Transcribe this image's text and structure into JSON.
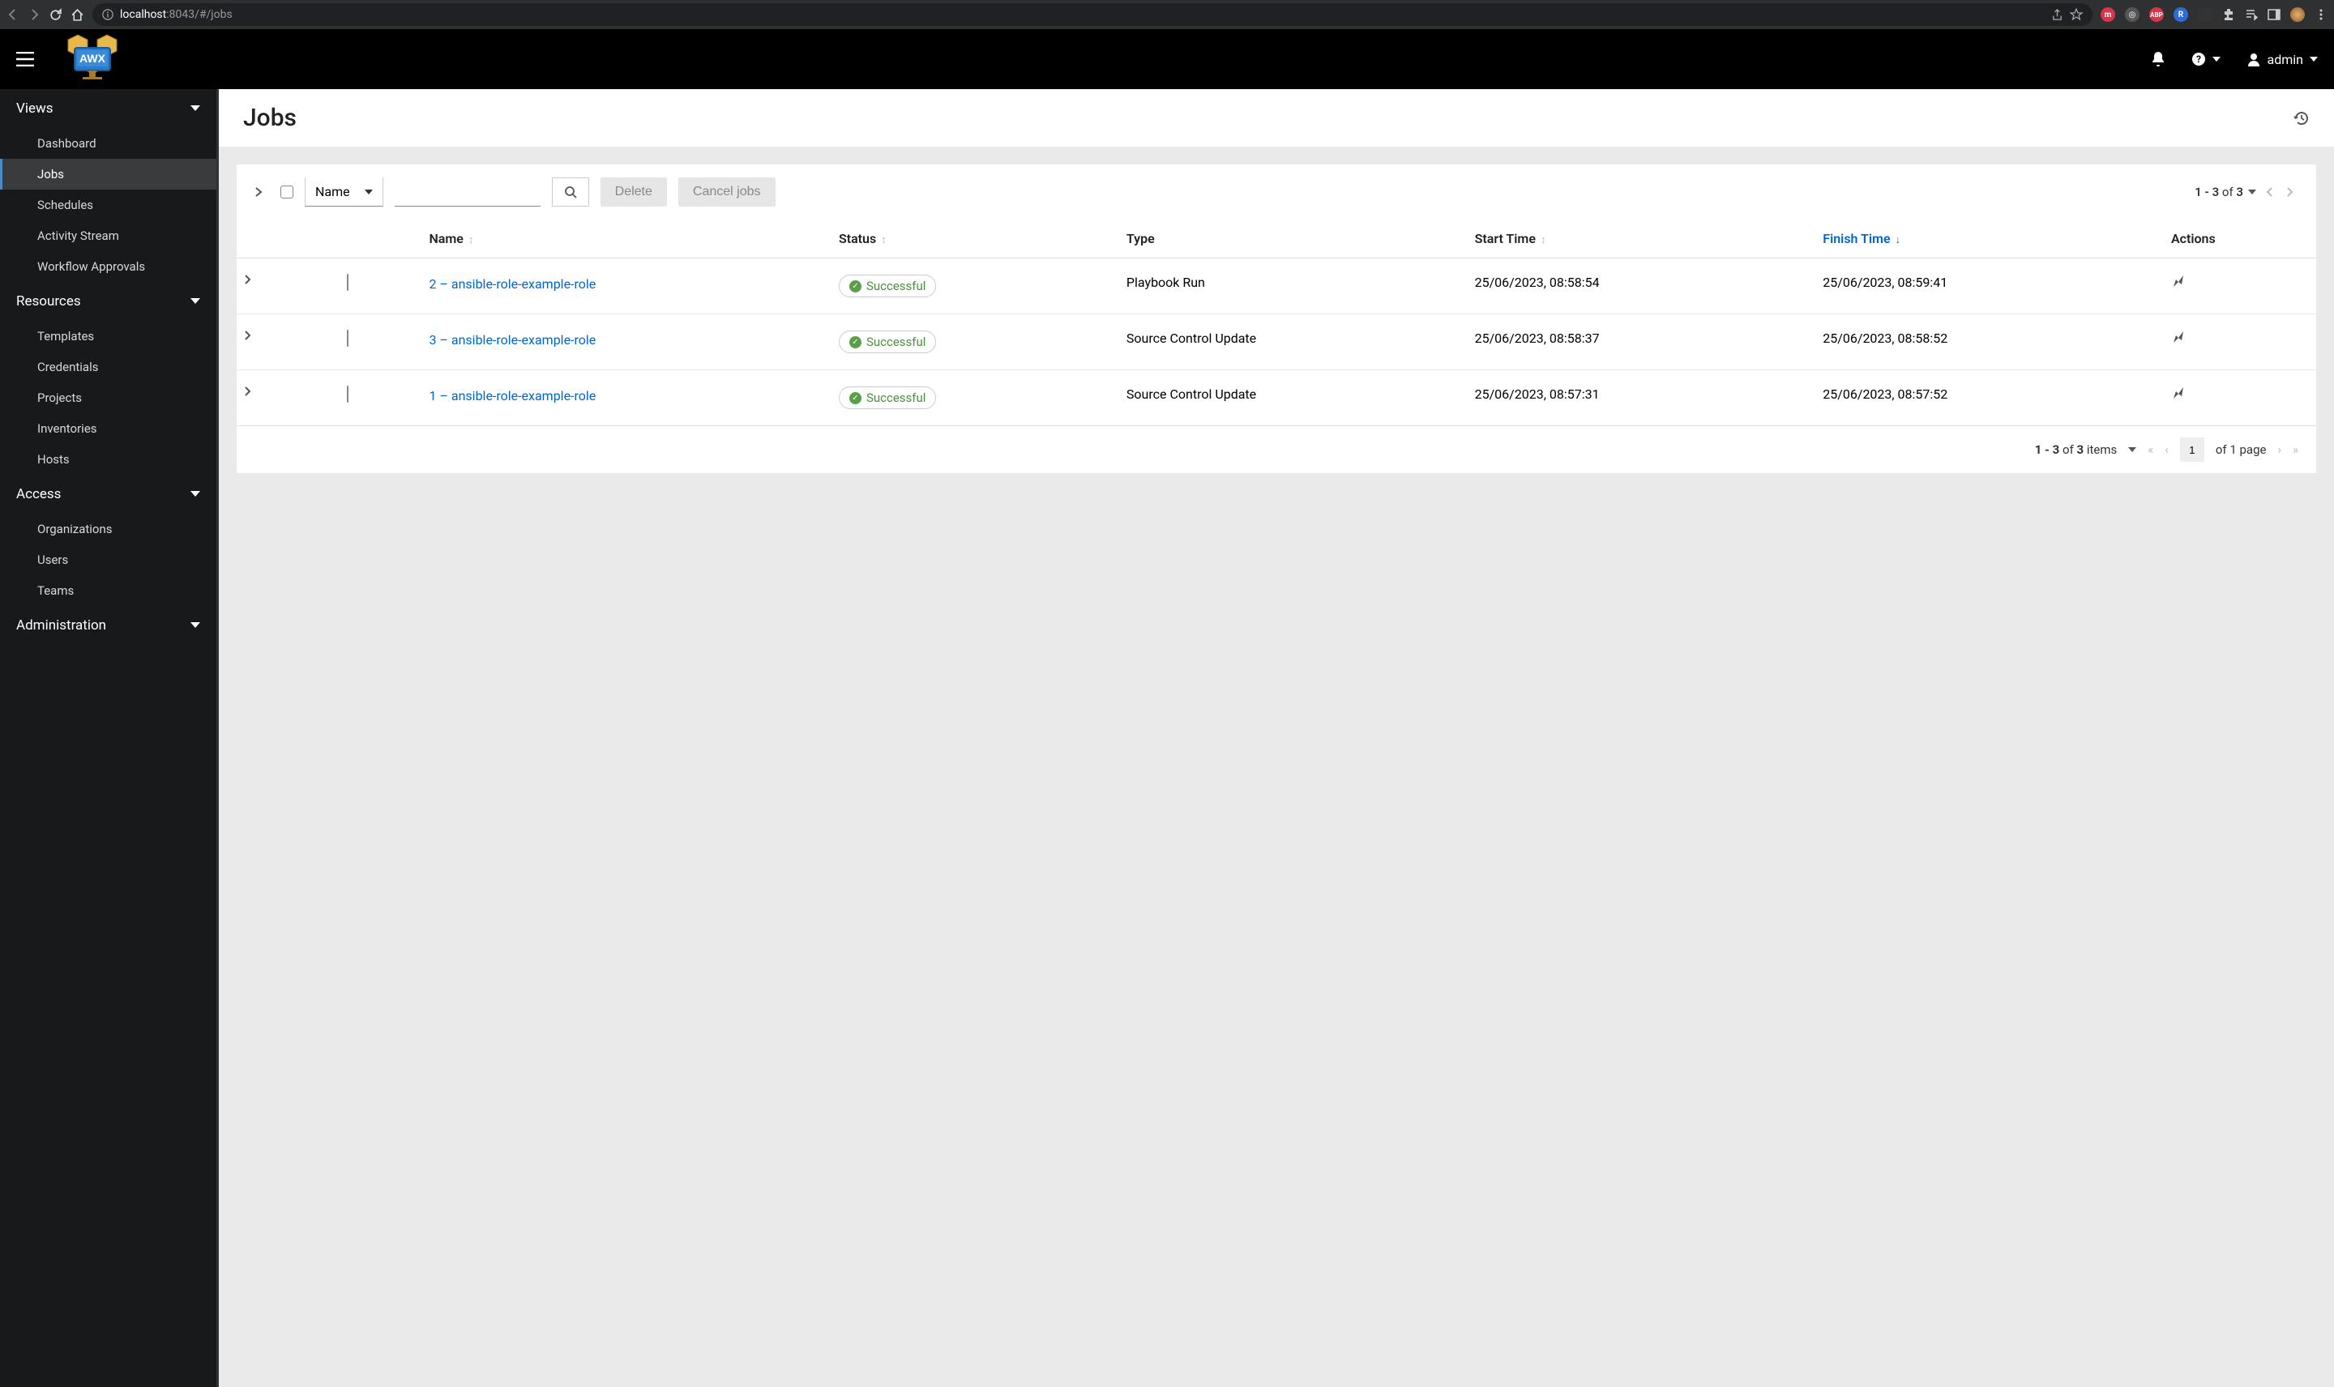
{
  "browser": {
    "url_host": "localhost",
    "url_port": ":8043",
    "url_path": "/#/jobs"
  },
  "header": {
    "logo_text": "AWX",
    "username": "admin"
  },
  "sidebar": {
    "sections": [
      {
        "label": "Views",
        "items": [
          {
            "label": "Dashboard",
            "active": false
          },
          {
            "label": "Jobs",
            "active": true
          },
          {
            "label": "Schedules",
            "active": false
          },
          {
            "label": "Activity Stream",
            "active": false
          },
          {
            "label": "Workflow Approvals",
            "active": false
          }
        ]
      },
      {
        "label": "Resources",
        "items": [
          {
            "label": "Templates"
          },
          {
            "label": "Credentials"
          },
          {
            "label": "Projects"
          },
          {
            "label": "Inventories"
          },
          {
            "label": "Hosts"
          }
        ]
      },
      {
        "label": "Access",
        "items": [
          {
            "label": "Organizations"
          },
          {
            "label": "Users"
          },
          {
            "label": "Teams"
          }
        ]
      },
      {
        "label": "Administration",
        "items": []
      }
    ]
  },
  "page": {
    "title": "Jobs"
  },
  "toolbar": {
    "filter_key": "Name",
    "search_placeholder": "",
    "delete_label": "Delete",
    "cancel_label": "Cancel jobs",
    "page_range": "1 - 3",
    "page_of": "of",
    "page_total": "3"
  },
  "table": {
    "columns": {
      "name": "Name",
      "status": "Status",
      "type": "Type",
      "start": "Start Time",
      "finish": "Finish Time",
      "actions": "Actions"
    },
    "rows": [
      {
        "name": "2 – ansible-role-example-role",
        "status": "Successful",
        "type": "Playbook Run",
        "start": "25/06/2023, 08:58:54",
        "finish": "25/06/2023, 08:59:41"
      },
      {
        "name": "3 – ansible-role-example-role",
        "status": "Successful",
        "type": "Source Control Update",
        "start": "25/06/2023, 08:58:37",
        "finish": "25/06/2023, 08:58:52"
      },
      {
        "name": "1 – ansible-role-example-role",
        "status": "Successful",
        "type": "Source Control Update",
        "start": "25/06/2023, 08:57:31",
        "finish": "25/06/2023, 08:57:52"
      }
    ]
  },
  "footer": {
    "items_range": "1 - 3",
    "items_of": "of",
    "items_total": "3",
    "items_label": "items",
    "page_current": "1",
    "page_of": "of 1 page"
  }
}
